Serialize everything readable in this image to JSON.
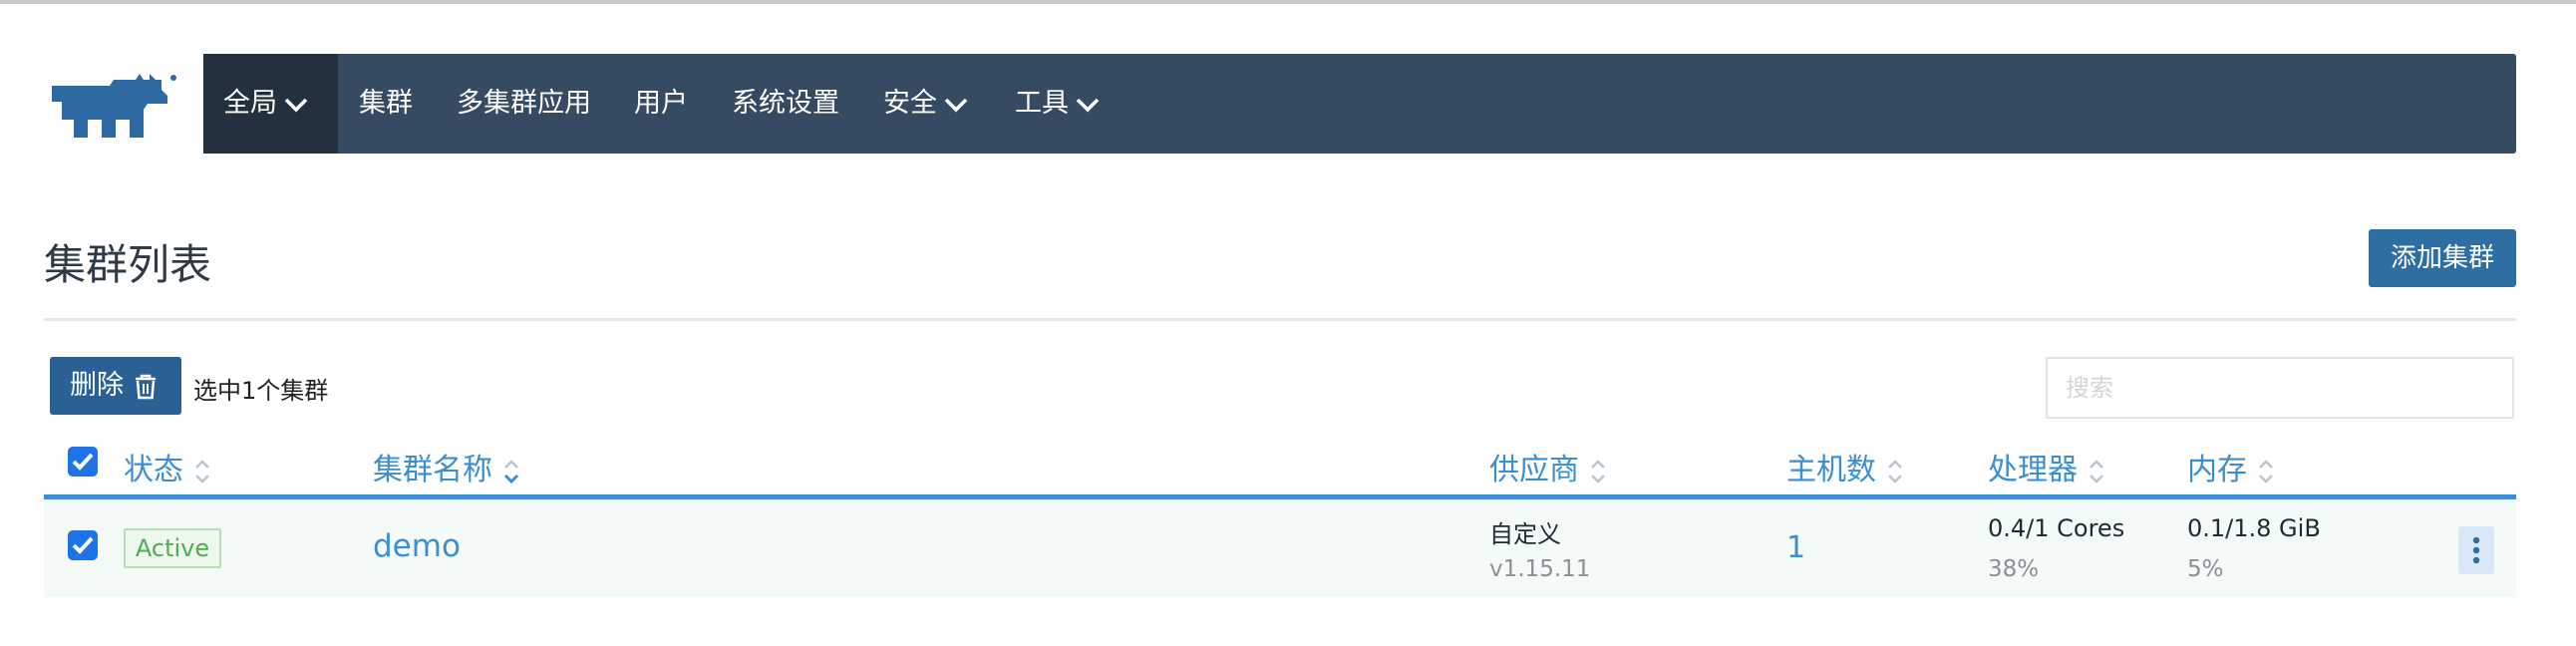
{
  "nav": {
    "items": [
      {
        "label": "全局",
        "has_dropdown": true,
        "active": true
      },
      {
        "label": "集群",
        "has_dropdown": false,
        "active": false
      },
      {
        "label": "多集群应用",
        "has_dropdown": false,
        "active": false
      },
      {
        "label": "用户",
        "has_dropdown": false,
        "active": false
      },
      {
        "label": "系统设置",
        "has_dropdown": false,
        "active": false
      },
      {
        "label": "安全",
        "has_dropdown": true,
        "active": false
      },
      {
        "label": "工具",
        "has_dropdown": true,
        "active": false
      }
    ],
    "logo_icon": "rancher-cow-logo",
    "avatar_icon": "identicon-avatar",
    "colors": {
      "bar": "#364a61",
      "active": "#23313f"
    }
  },
  "page": {
    "title": "集群列表",
    "add_button": "添加集群"
  },
  "toolbar": {
    "delete_button": "删除",
    "delete_icon": "trash-icon",
    "selected_text": "选中1个集群",
    "search_placeholder": "搜索"
  },
  "table": {
    "select_all_checked": true,
    "columns": [
      {
        "label": "状态",
        "sortable": true
      },
      {
        "label": "集群名称",
        "sortable": true
      },
      {
        "label": "供应商",
        "sortable": true
      },
      {
        "label": "主机数",
        "sortable": true
      },
      {
        "label": "处理器",
        "sortable": true
      },
      {
        "label": "内存",
        "sortable": true
      }
    ],
    "rows": [
      {
        "checked": true,
        "state": "Active",
        "name": "demo",
        "provider": "自定义",
        "version": "v1.15.11",
        "nodes": "1",
        "cpu": "0.4/1 Cores",
        "cpu_pct": "38%",
        "memory": "0.1/1.8 GiB",
        "memory_pct": "5%"
      }
    ]
  },
  "colors": {
    "accent": "#3c8ed0",
    "primary_button": "#2f6ea3",
    "active_badge": "#4cae4c"
  }
}
